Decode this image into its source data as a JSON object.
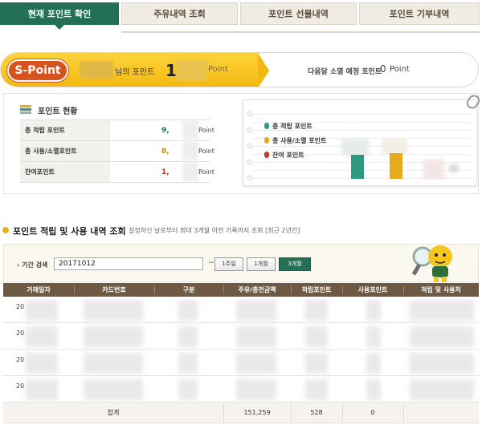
{
  "tabs": [
    {
      "label": "현재 포인트 확인",
      "active": true
    },
    {
      "label": "주유내역 조회",
      "active": false
    },
    {
      "label": "포인트 선물내역",
      "active": false
    },
    {
      "label": "포인트 기부내역",
      "active": false
    }
  ],
  "banner": {
    "badge": "S-Point",
    "name_suffix": "님의 포인트",
    "point_visible": "1",
    "point_unit": "Point",
    "expire_label": "다음달 소멸 예정 포인트",
    "expire_value": "0",
    "expire_unit": "Point"
  },
  "status": {
    "title": "포인트 현황",
    "rows": [
      {
        "label": "총 적립 포인트",
        "value": "9,",
        "unit": "Point",
        "color": "#1f6f52"
      },
      {
        "label": "총 사용/소멸포인트",
        "value": "8,",
        "unit": "Point",
        "color": "#c58a0a"
      },
      {
        "label": "잔여포인트",
        "value": "1,",
        "unit": "Point",
        "color": "#b8311e"
      }
    ]
  },
  "chart": {
    "legend": [
      {
        "label": "총 적립 포인트",
        "color": "#2e9a84"
      },
      {
        "label": "총 사용/소멸 포인트",
        "color": "#e6aa1c"
      },
      {
        "label": "잔여 포인트",
        "color": "#c0392b"
      }
    ],
    "colors": {
      "accumulated": "#2e9a84",
      "used": "#e6aa1c",
      "remaining": "#c0392b"
    }
  },
  "history": {
    "title": "포인트 적립 및 사용 내역 조회",
    "desc": "설정하신 날로부터 최대 3개월 이전 기록까지 조회 [최근 2년간]",
    "search_label": "기간 검색",
    "search_value": "20171012",
    "tilde": "~",
    "buttons": [
      "1주일",
      "1개월",
      "3개월"
    ],
    "columns": [
      "거래일자",
      "카드번호",
      "구분",
      "주유/충전금액",
      "적립포인트",
      "사용포인트",
      "적립 및 사용처"
    ],
    "row_prefixes": [
      "20",
      "20",
      "20",
      "20"
    ],
    "total": {
      "label": "합계",
      "charge": "151,259",
      "earned": "528",
      "used": "0"
    }
  },
  "colors": {
    "brand_green": "#237057",
    "header_brown": "#6e5a43",
    "spoint_orange": "#d7531d",
    "banner_yellow": "#f3b80e"
  }
}
